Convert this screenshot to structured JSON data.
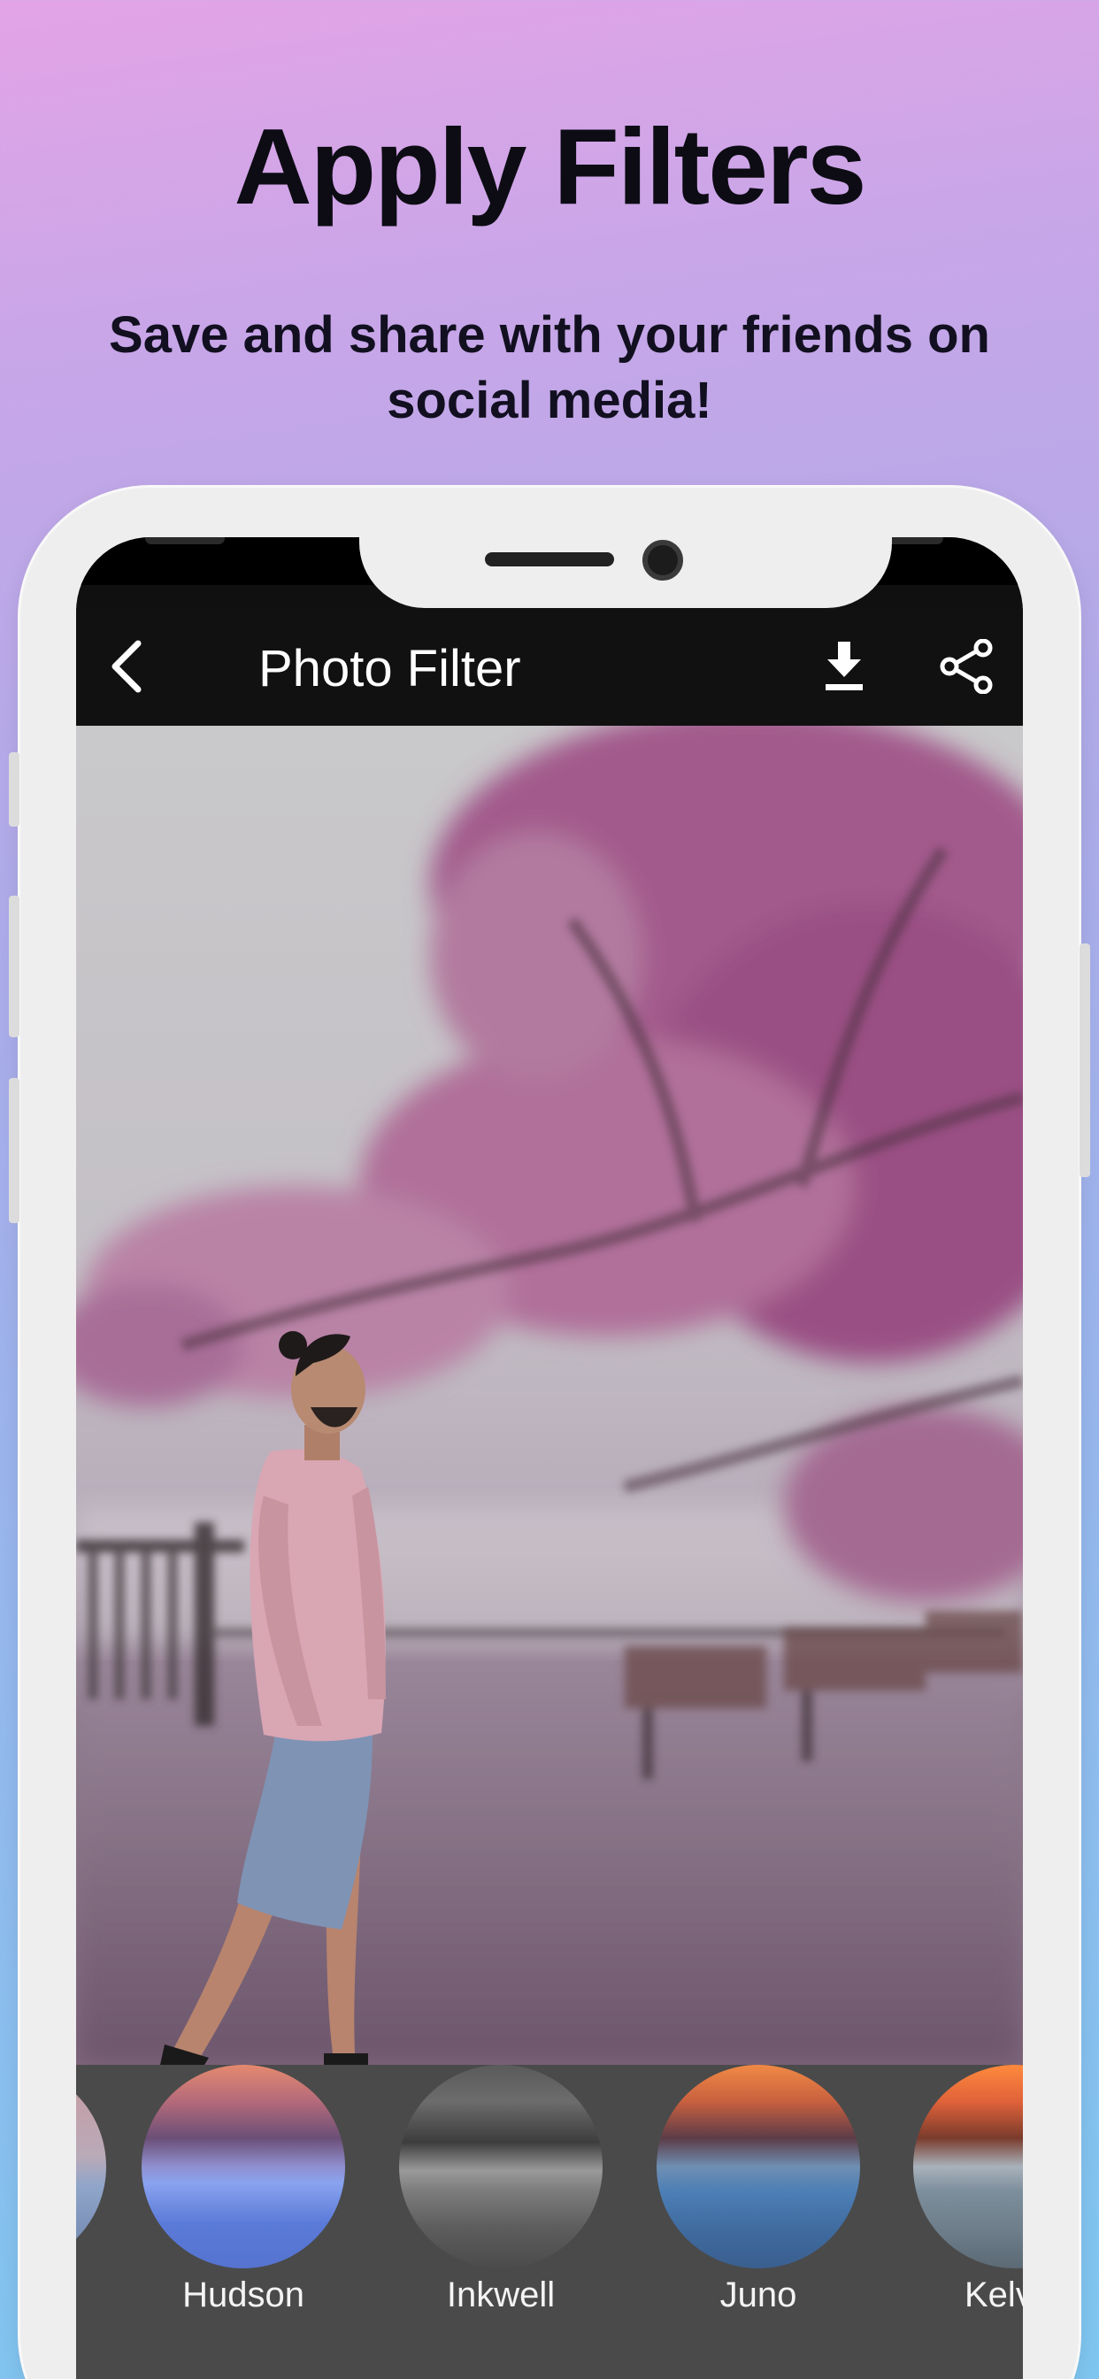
{
  "promo": {
    "headline": "Apply Filters",
    "subline": "Save and share with your friends on social media!"
  },
  "app": {
    "title": "Photo Filter",
    "icons": {
      "back": "back-arrow-icon",
      "download": "download-icon",
      "share": "share-icon"
    },
    "colors": {
      "appbar": "#111111",
      "filter_strip": "#4a4a4a"
    }
  },
  "filters": [
    {
      "label": ""
    },
    {
      "label": "Hudson"
    },
    {
      "label": "Inkwell"
    },
    {
      "label": "Juno"
    },
    {
      "label": "Kelv"
    }
  ]
}
